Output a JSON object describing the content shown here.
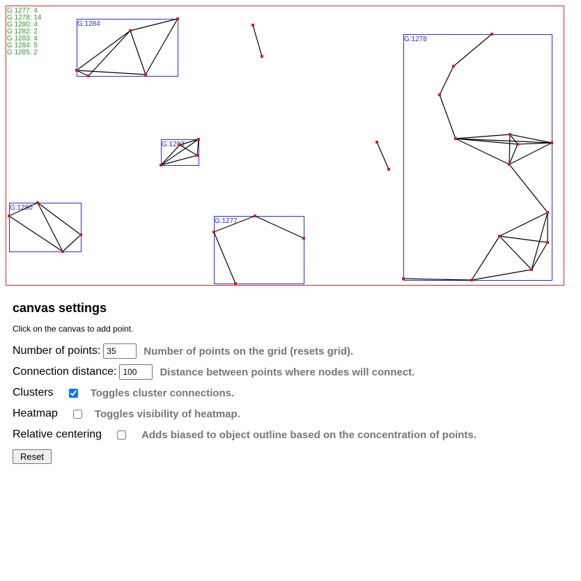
{
  "legend": [
    "G 1277: 4",
    "G 1278: 14",
    "G 1280: 4",
    "G 1282: 2",
    "G 1283: 4",
    "G 1284: 5",
    "G 1285: 2"
  ],
  "clusters": [
    {
      "label": "G:1284",
      "points": [
        [
          101,
          92
        ],
        [
          118,
          100
        ],
        [
          178,
          35
        ],
        [
          200,
          98
        ],
        [
          246,
          18
        ]
      ],
      "edges": [
        [
          0,
          2
        ],
        [
          0,
          1
        ],
        [
          0,
          3
        ],
        [
          1,
          2
        ],
        [
          2,
          4
        ],
        [
          2,
          3
        ],
        [
          3,
          4
        ]
      ]
    },
    {
      "label": "G:1283",
      "points": [
        [
          222,
          228
        ],
        [
          249,
          199
        ],
        [
          276,
          191
        ],
        [
          274,
          214
        ]
      ],
      "edges": [
        [
          0,
          1
        ],
        [
          0,
          2
        ],
        [
          0,
          3
        ],
        [
          1,
          2
        ],
        [
          1,
          3
        ],
        [
          2,
          3
        ]
      ]
    },
    {
      "label": "G:1280",
      "points": [
        [
          4,
          301
        ],
        [
          45,
          282
        ],
        [
          81,
          352
        ],
        [
          107,
          328
        ]
      ],
      "edges": [
        [
          0,
          1
        ],
        [
          0,
          2
        ],
        [
          1,
          2
        ],
        [
          1,
          3
        ],
        [
          2,
          3
        ]
      ]
    },
    {
      "label": "G:1277",
      "points": [
        [
          298,
          324
        ],
        [
          357,
          301
        ],
        [
          427,
          333
        ],
        [
          329,
          398
        ]
      ],
      "edges": [
        [
          0,
          1
        ],
        [
          1,
          2
        ],
        [
          0,
          3
        ]
      ]
    },
    {
      "label": "G:1278",
      "points": [
        [
          697,
          40
        ],
        [
          642,
          86
        ],
        [
          622,
          127
        ],
        [
          645,
          190
        ],
        [
          723,
          184
        ],
        [
          734,
          198
        ],
        [
          783,
          196
        ],
        [
          722,
          227
        ],
        [
          777,
          296
        ],
        [
          708,
          330
        ],
        [
          777,
          339
        ],
        [
          754,
          378
        ],
        [
          668,
          393
        ],
        [
          570,
          391
        ]
      ],
      "edges": [
        [
          0,
          1
        ],
        [
          1,
          2
        ],
        [
          2,
          3
        ],
        [
          3,
          4
        ],
        [
          3,
          5
        ],
        [
          3,
          6
        ],
        [
          3,
          7
        ],
        [
          4,
          5
        ],
        [
          4,
          6
        ],
        [
          4,
          7
        ],
        [
          5,
          6
        ],
        [
          5,
          7
        ],
        [
          6,
          7
        ],
        [
          7,
          8
        ],
        [
          8,
          9
        ],
        [
          8,
          10
        ],
        [
          8,
          11
        ],
        [
          9,
          10
        ],
        [
          9,
          11
        ],
        [
          9,
          12
        ],
        [
          10,
          11
        ],
        [
          11,
          12
        ],
        [
          12,
          13
        ]
      ]
    }
  ],
  "pairs": [
    {
      "label": "G 1282",
      "points": [
        [
          354,
          27
        ],
        [
          367,
          72
        ]
      ]
    },
    {
      "label": "G 1285",
      "points": [
        [
          532,
          195
        ],
        [
          549,
          234
        ]
      ]
    }
  ],
  "settings": {
    "title": "canvas settings",
    "hint": "Click on the canvas to add point.",
    "points_label": "Number of points:",
    "points_value": "35",
    "points_desc": "Number of points on the grid (resets grid).",
    "distance_label": "Connection distance:",
    "distance_value": "100",
    "distance_desc": "Distance between points where nodes will connect.",
    "clusters_label": "Clusters",
    "clusters_checked": true,
    "clusters_desc": "Toggles cluster connections.",
    "heatmap_label": "Heatmap",
    "heatmap_checked": false,
    "heatmap_desc": "Toggles visibility of heatmap.",
    "centering_label": "Relative centering",
    "centering_checked": false,
    "centering_desc": "Adds biased to object outline based on the concentration of points.",
    "reset_label": "Reset"
  },
  "colors": {
    "border": "#dd2222",
    "box": "#2a2ad8",
    "edge": "#000000",
    "point": "#d81b1b",
    "legend": "#2a9a2a",
    "desc": "#777777"
  }
}
